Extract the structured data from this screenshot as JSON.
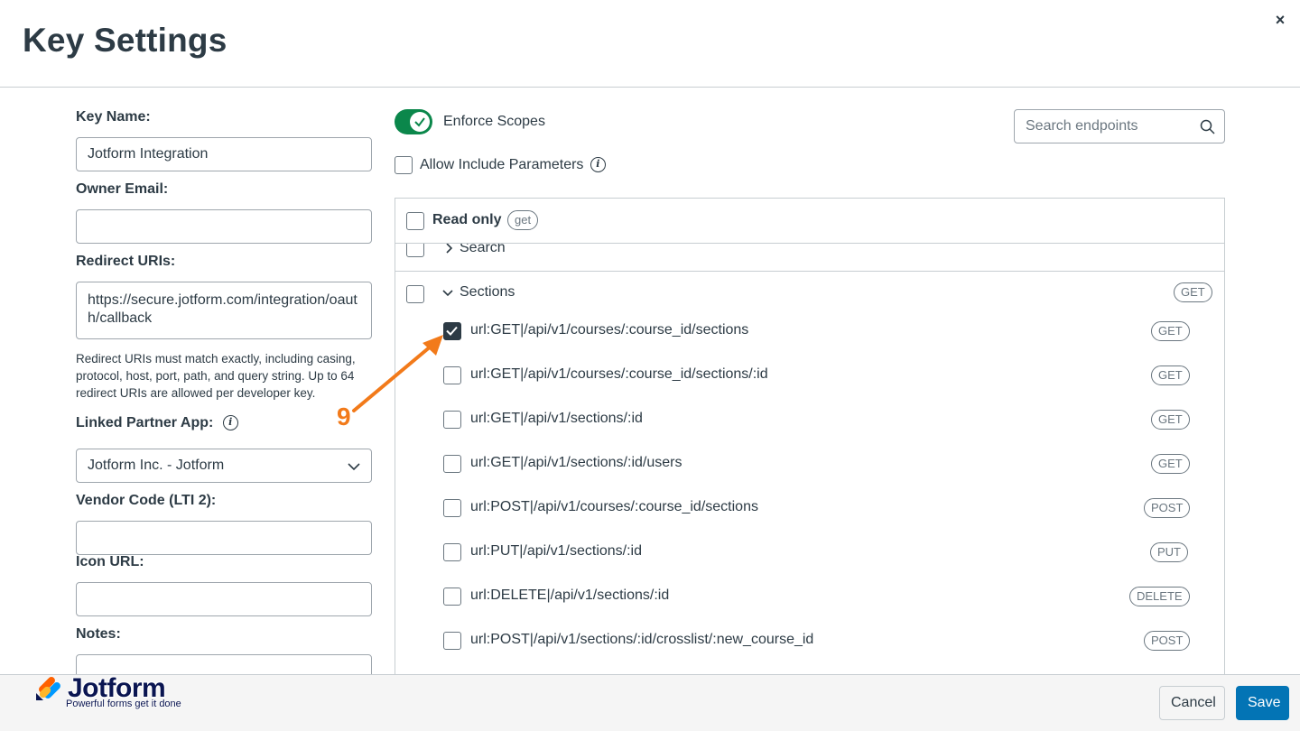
{
  "header": {
    "title": "Key Settings",
    "close_label": "×"
  },
  "form": {
    "key_name_label": "Key Name:",
    "key_name_value": "Jotform Integration",
    "owner_email_label": "Owner Email:",
    "owner_email_value": "",
    "redirect_label": "Redirect URIs:",
    "redirect_value": "https://secure.jotform.com/integration/oauth/callback",
    "redirect_help": "Redirect URIs must match exactly, including casing, protocol, host, port, path, and query string. Up to 64 redirect URIs are allowed per developer key.",
    "partner_label": "Linked Partner App:",
    "partner_value": "Jotform Inc. - Jotform",
    "vendor_label": "Vendor Code (LTI 2):",
    "vendor_value": "",
    "icon_url_label": "Icon URL:",
    "icon_url_value": "",
    "notes_label": "Notes:"
  },
  "scopes": {
    "enforce_label": "Enforce Scopes",
    "enforce_on": true,
    "allow_include_label": "Allow Include Parameters",
    "search_placeholder": "Search endpoints",
    "read_only_label": "Read only",
    "read_only_pill": "get",
    "groups": [
      {
        "name": "Search",
        "expanded": false
      },
      {
        "name": "Sections",
        "expanded": true,
        "pill": "GET"
      }
    ],
    "endpoints": [
      {
        "label": "url:GET|/api/v1/courses/:course_id/sections",
        "method": "GET",
        "checked": true
      },
      {
        "label": "url:GET|/api/v1/courses/:course_id/sections/:id",
        "method": "GET",
        "checked": false
      },
      {
        "label": "url:GET|/api/v1/sections/:id",
        "method": "GET",
        "checked": false
      },
      {
        "label": "url:GET|/api/v1/sections/:id/users",
        "method": "GET",
        "checked": false
      },
      {
        "label": "url:POST|/api/v1/courses/:course_id/sections",
        "method": "POST",
        "checked": false
      },
      {
        "label": "url:PUT|/api/v1/sections/:id",
        "method": "PUT",
        "checked": false
      },
      {
        "label": "url:DELETE|/api/v1/sections/:id",
        "method": "DELETE",
        "checked": false
      },
      {
        "label": "url:POST|/api/v1/sections/:id/crosslist/:new_course_id",
        "method": "POST",
        "checked": false
      }
    ]
  },
  "footer": {
    "cancel_label": "Cancel",
    "save_label": "Save"
  },
  "watermark": {
    "brand": "Jotform",
    "tagline": "Powerful forms get it done"
  },
  "annotation": {
    "step": "9",
    "color": "#f27a1a"
  }
}
